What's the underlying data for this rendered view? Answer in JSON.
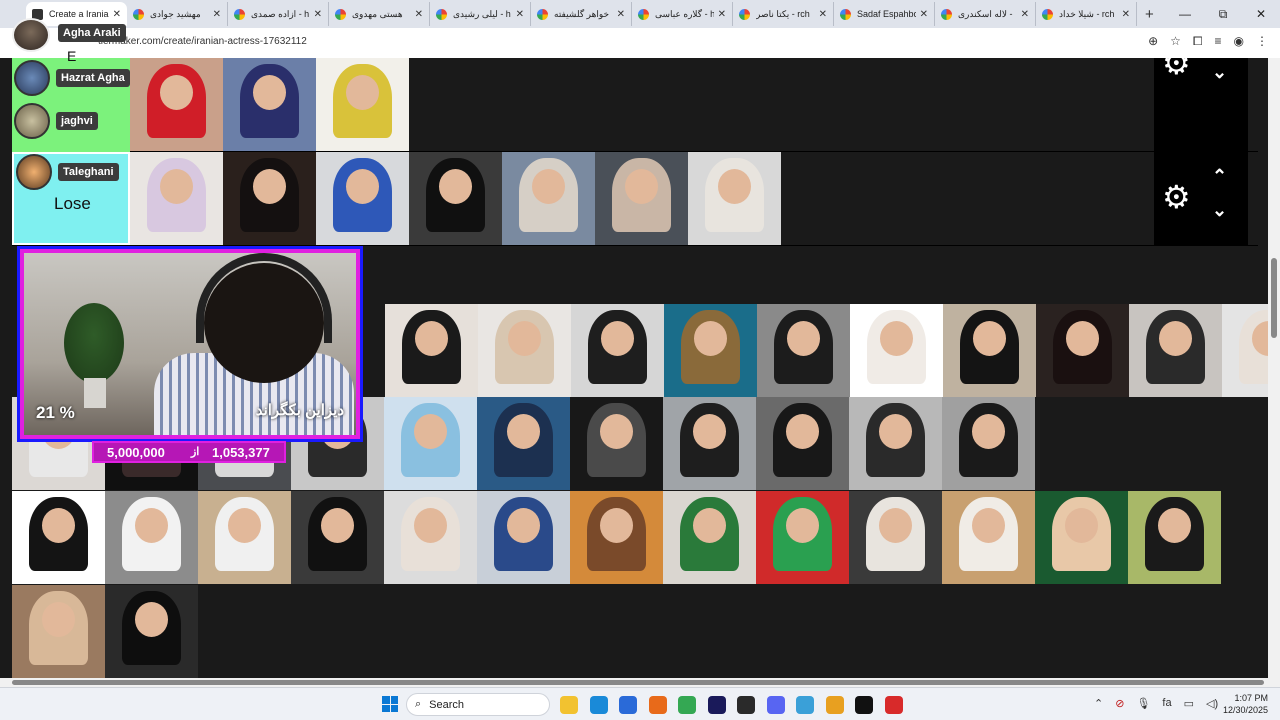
{
  "browser": {
    "tabs": [
      {
        "title": "Create a Irania",
        "active": true,
        "icon": "tiermaker-favicon"
      },
      {
        "title": "مهشید جوادی",
        "active": false,
        "icon": "google-favicon"
      },
      {
        "title": "ازاده صمدی - h",
        "active": false,
        "icon": "google-favicon"
      },
      {
        "title": "هستی مهدوی",
        "active": false,
        "icon": "google-favicon"
      },
      {
        "title": "لیلی رشیدی - h",
        "active": false,
        "icon": "google-favicon"
      },
      {
        "title": "خواهر گلشیفته",
        "active": false,
        "icon": "google-favicon"
      },
      {
        "title": "گلاره عباسی - h",
        "active": false,
        "icon": "google-favicon"
      },
      {
        "title": "یکتا ناصر - rch",
        "active": false,
        "icon": "google-favicon"
      },
      {
        "title": "Sadaf Espahbo",
        "active": false,
        "icon": "google-favicon"
      },
      {
        "title": "لاله اسکندری -",
        "active": false,
        "icon": "google-favicon"
      },
      {
        "title": "شیلا خداد - rch",
        "active": false,
        "icon": "google-favicon"
      }
    ],
    "new_tab": "+",
    "window_controls": {
      "minimize": "—",
      "maximize": "⧉",
      "close": "✕"
    },
    "url": "tiermaker.com/create/iranian-actress-17632112",
    "profile_name": "Agha Araki"
  },
  "tierlist": {
    "rows": [
      {
        "users": [
          {
            "name": "Hazrat Agha"
          },
          {
            "name": "jaghvi"
          }
        ],
        "label_partial": "E",
        "photos": [
          {
            "bg": "#c9a08a",
            "scarf": "#d01e28"
          },
          {
            "bg": "#6b7fa8",
            "scarf": "#2a2f6b"
          },
          {
            "bg": "#f2f0ea",
            "scarf": "#d9c23a"
          }
        ]
      },
      {
        "users": [
          {
            "name": "Taleghani"
          }
        ],
        "label": "Lose",
        "photos": [
          {
            "bg": "#e9e5e2",
            "scarf": "#d8c8e0"
          },
          {
            "bg": "#2a201c",
            "scarf": "#141010"
          },
          {
            "bg": "#d7d9dc",
            "scarf": "#2e58b8"
          },
          {
            "bg": "#3a3a3a",
            "scarf": "#101010"
          },
          {
            "bg": "#7a8aa0",
            "scarf": "#d6cfc6"
          },
          {
            "bg": "#4a5058",
            "scarf": "#c9b6a6"
          },
          {
            "bg": "#d8d8d8",
            "scarf": "#e8e4de"
          }
        ]
      }
    ],
    "controls": {
      "settings_icon": "gear-icon",
      "up_icon": "chevron-up-icon",
      "down_icon": "chevron-down-icon"
    },
    "pool_rows": [
      [
        {
          "bg": "#e6e0da",
          "scarf": "#1a1a1a"
        },
        {
          "bg": "#e9e6e3",
          "scarf": "#d8c6b0"
        },
        {
          "bg": "#d6d6d6",
          "scarf": "#1e1e1e"
        },
        {
          "bg": "#1a6d8a",
          "scarf": "#8a6a3a"
        },
        {
          "bg": "#8a8a8a",
          "scarf": "#1c1c1c"
        },
        {
          "bg": "#ffffff",
          "scarf": "#f0ebe6"
        },
        {
          "bg": "#bfb2a0",
          "scarf": "#141414"
        },
        {
          "bg": "#2a2220",
          "scarf": "#1a1010"
        },
        {
          "bg": "#c8c4c0",
          "scarf": "#2a2a2a"
        },
        {
          "bg": "#e4e4e4",
          "scarf": "#e8e0d8"
        }
      ],
      [
        {
          "bg": "#dcd8d4",
          "scarf": "#e8e8e8"
        },
        {
          "bg": "#101010",
          "scarf": "#3a2a2a"
        },
        {
          "bg": "#4a4c50",
          "scarf": "#d8d8d8"
        },
        {
          "bg": "#c8c8c8",
          "scarf": "#2a2a2a"
        },
        {
          "bg": "#cfe0ee",
          "scarf": "#8ac0e0"
        },
        {
          "bg": "#2a5a86",
          "scarf": "#1c3050"
        },
        {
          "bg": "#181818",
          "scarf": "#4a4a4a"
        },
        {
          "bg": "#a0a4a8",
          "scarf": "#1e1e1e"
        },
        {
          "bg": "#6a6a6a",
          "scarf": "#181818"
        },
        {
          "bg": "#b8b8b8",
          "scarf": "#2a2a2a"
        },
        {
          "bg": "#a0a0a0",
          "scarf": "#1a1a1a"
        }
      ],
      [
        {
          "bg": "#ffffff",
          "scarf": "#141414"
        },
        {
          "bg": "#8c8c8c",
          "scarf": "#f2f2f2"
        },
        {
          "bg": "#c8b090",
          "scarf": "#f0f0f0"
        },
        {
          "bg": "#3a3a3a",
          "scarf": "#111111"
        },
        {
          "bg": "#dcdcdc",
          "scarf": "#e8e0d8"
        },
        {
          "bg": "#c8cfd8",
          "scarf": "#2a4a8a"
        },
        {
          "bg": "#d48a3a",
          "scarf": "#7a4a2a"
        },
        {
          "bg": "#dad6d0",
          "scarf": "#2a7a3a"
        },
        {
          "bg": "#d02a2a",
          "scarf": "#2aa050"
        },
        {
          "bg": "#3a3a3a",
          "scarf": "#e8e4de"
        },
        {
          "bg": "#c8a070",
          "scarf": "#f0ece6"
        },
        {
          "bg": "#1a5a30",
          "scarf": "#e8c8a8"
        },
        {
          "bg": "#a8b868",
          "scarf": "#1a1a1a"
        }
      ],
      [
        {
          "bg": "#9a7a60",
          "scarf": "#d8b898"
        },
        {
          "bg": "#2a2a2a",
          "scarf": "#0e0e0e"
        }
      ]
    ]
  },
  "stream": {
    "progress_percent": "21 %",
    "caption": "دیزاین بکگراند",
    "goal_target": "5,000,000",
    "goal_of": "از",
    "goal_current": "1,053,377"
  },
  "taskbar": {
    "search_placeholder": "Search",
    "time": "1:07 PM",
    "date": "12/30/2025",
    "lang": "fa",
    "apps": [
      {
        "name": "file-explorer-icon",
        "color": "#f2c230"
      },
      {
        "name": "edge-icon",
        "color": "#1a8ad8"
      },
      {
        "name": "store-icon",
        "color": "#2a6ad8"
      },
      {
        "name": "firefox-icon",
        "color": "#e86a1a"
      },
      {
        "name": "chrome-icon",
        "color": "#34a853"
      },
      {
        "name": "premiere-icon",
        "color": "#1a1a5a"
      },
      {
        "name": "obs-icon",
        "color": "#2a2a2a"
      },
      {
        "name": "discord-icon",
        "color": "#5865f2"
      },
      {
        "name": "notepad-icon",
        "color": "#3aa0d8"
      },
      {
        "name": "vlc-icon",
        "color": "#e8a020"
      },
      {
        "name": "epic-games-icon",
        "color": "#111111"
      },
      {
        "name": "record-icon",
        "color": "#d82a2a"
      }
    ]
  }
}
